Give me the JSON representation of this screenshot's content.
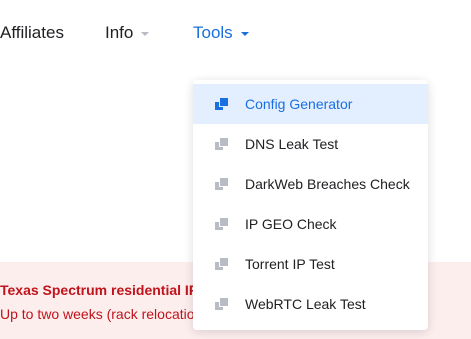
{
  "nav": {
    "affiliates": "Affiliates",
    "info": "Info",
    "tools": "Tools"
  },
  "tools_menu": {
    "items": [
      {
        "label": "Config Generator",
        "active": true,
        "icon": "copy-icon"
      },
      {
        "label": "DNS Leak Test",
        "active": false,
        "icon": "copy-icon"
      },
      {
        "label": "DarkWeb Breaches Check",
        "active": false,
        "icon": "copy-icon"
      },
      {
        "label": "IP GEO Check",
        "active": false,
        "icon": "copy-icon"
      },
      {
        "label": "Torrent IP Test",
        "active": false,
        "icon": "copy-icon"
      },
      {
        "label": "WebRTC Leak Test",
        "active": false,
        "icon": "copy-icon"
      }
    ]
  },
  "alert": {
    "title": "Texas Spectrum residential IP a",
    "text": "Up to two weeks (rack relocatio"
  },
  "colors": {
    "accent": "#1a6fe0",
    "alert_text": "#c0131b",
    "alert_bg": "#fdeeee",
    "active_bg": "#e3efff"
  }
}
